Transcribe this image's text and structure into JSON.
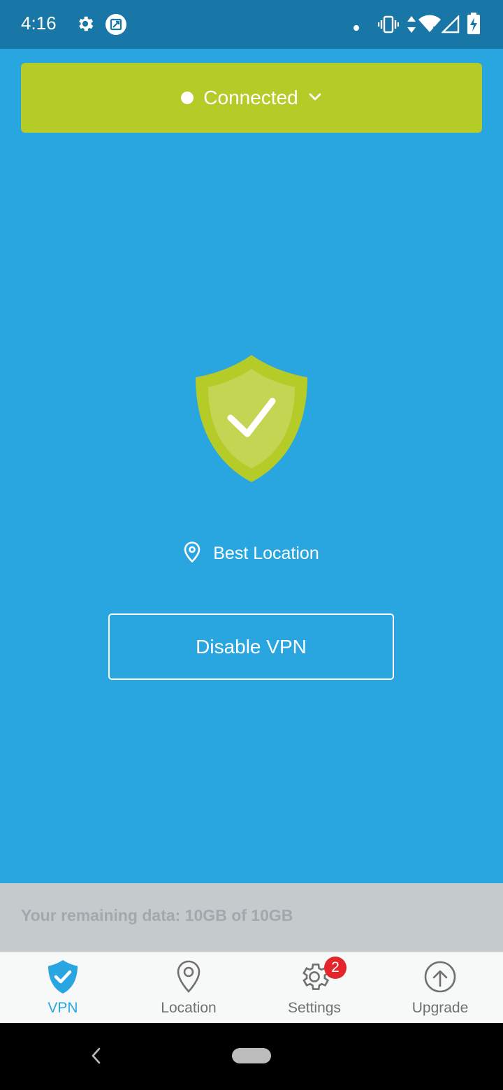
{
  "status_bar": {
    "time": "4:16",
    "icons": [
      "settings-icon",
      "screenshot-icon",
      "dot-icon",
      "vibrate-icon",
      "data-arrows-icon",
      "wifi-icon",
      "signal-icon",
      "battery-charging-icon"
    ]
  },
  "connection": {
    "status_label": "Connected",
    "banner_color": "#b5cb27"
  },
  "main": {
    "shield_icon": "shield-check-icon",
    "location_label": "Best Location",
    "disable_button_label": "Disable VPN"
  },
  "data_usage": {
    "text": "Your remaining data: 10GB of 10GB"
  },
  "bottom_nav": {
    "items": [
      {
        "label": "VPN",
        "icon": "shield-check-icon",
        "active": true
      },
      {
        "label": "Location",
        "icon": "map-pin-icon",
        "active": false
      },
      {
        "label": "Settings",
        "icon": "gear-icon",
        "active": false,
        "badge": "2"
      },
      {
        "label": "Upgrade",
        "icon": "upload-arrow-icon",
        "active": false
      }
    ]
  },
  "colors": {
    "background": "#29a6df",
    "status_bar": "#1877a6",
    "accent_green": "#b5cb27",
    "badge_red": "#e2262c"
  }
}
